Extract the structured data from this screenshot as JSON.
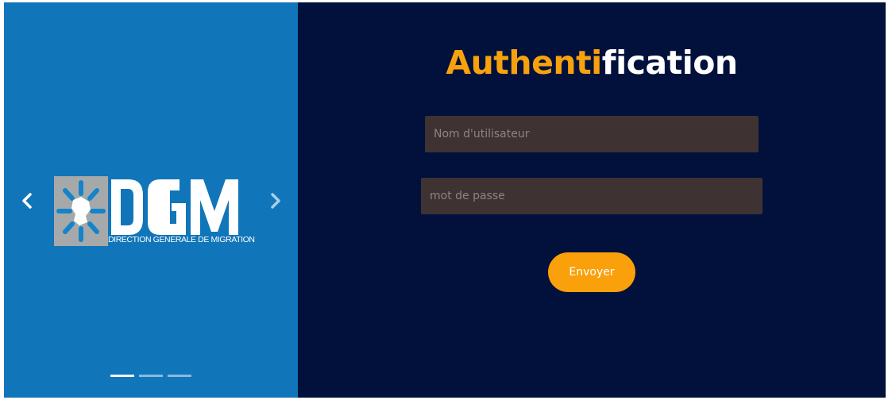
{
  "carousel": {
    "logo": {
      "name": "dgm-logo",
      "text": "DGM",
      "subtitle": "DIRECTION GENERALE DE MIGRATION"
    },
    "prev_icon": "chevron-left-icon",
    "next_icon": "chevron-right-icon",
    "indicators": [
      {
        "active": true
      },
      {
        "active": false
      },
      {
        "active": false
      }
    ],
    "colors": {
      "background": "#1175ba"
    }
  },
  "form": {
    "title_part1": "Authenti",
    "title_part2": "fication",
    "username_placeholder": "Nom d'utilisateur",
    "username_value": "",
    "password_placeholder": "mot de passe",
    "password_value": "",
    "submit_label": "Envoyer",
    "colors": {
      "background": "#01113b",
      "accent": "#f9a00b",
      "field": "#3f3232"
    }
  }
}
